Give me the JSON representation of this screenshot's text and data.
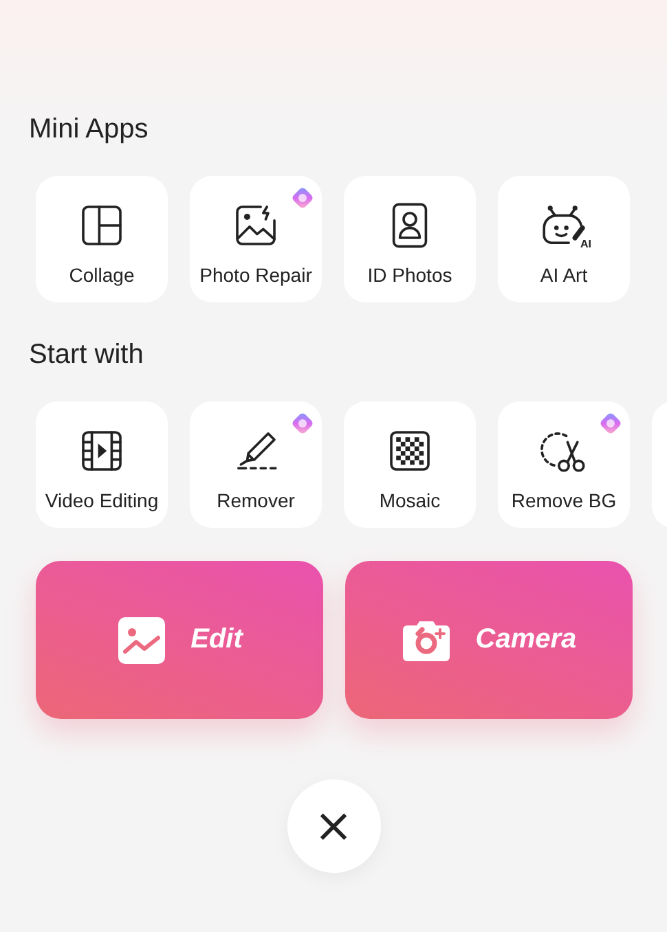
{
  "sections": [
    {
      "title": "Mini Apps",
      "tools": [
        {
          "label": "Collage",
          "kind": "collage",
          "premium": false
        },
        {
          "label": "Photo Repair",
          "kind": "photo",
          "premium": true
        },
        {
          "label": "ID Photos",
          "kind": "id",
          "premium": false
        },
        {
          "label": "AI Art",
          "kind": "ai",
          "icon_text": "AI",
          "premium": false
        }
      ]
    },
    {
      "title": "Start with",
      "tools": [
        {
          "label": "Video Editing",
          "kind": "video",
          "premium": false
        },
        {
          "label": "Remover",
          "kind": "eraser",
          "premium": true
        },
        {
          "label": "Mosaic",
          "kind": "mosaic",
          "premium": false
        },
        {
          "label": "Remove BG",
          "kind": "cutout",
          "premium": true
        }
      ]
    }
  ],
  "actions": [
    {
      "label": "Edit",
      "kind": "image"
    },
    {
      "label": "Camera",
      "kind": "camera"
    }
  ],
  "close": {
    "label": "×"
  }
}
